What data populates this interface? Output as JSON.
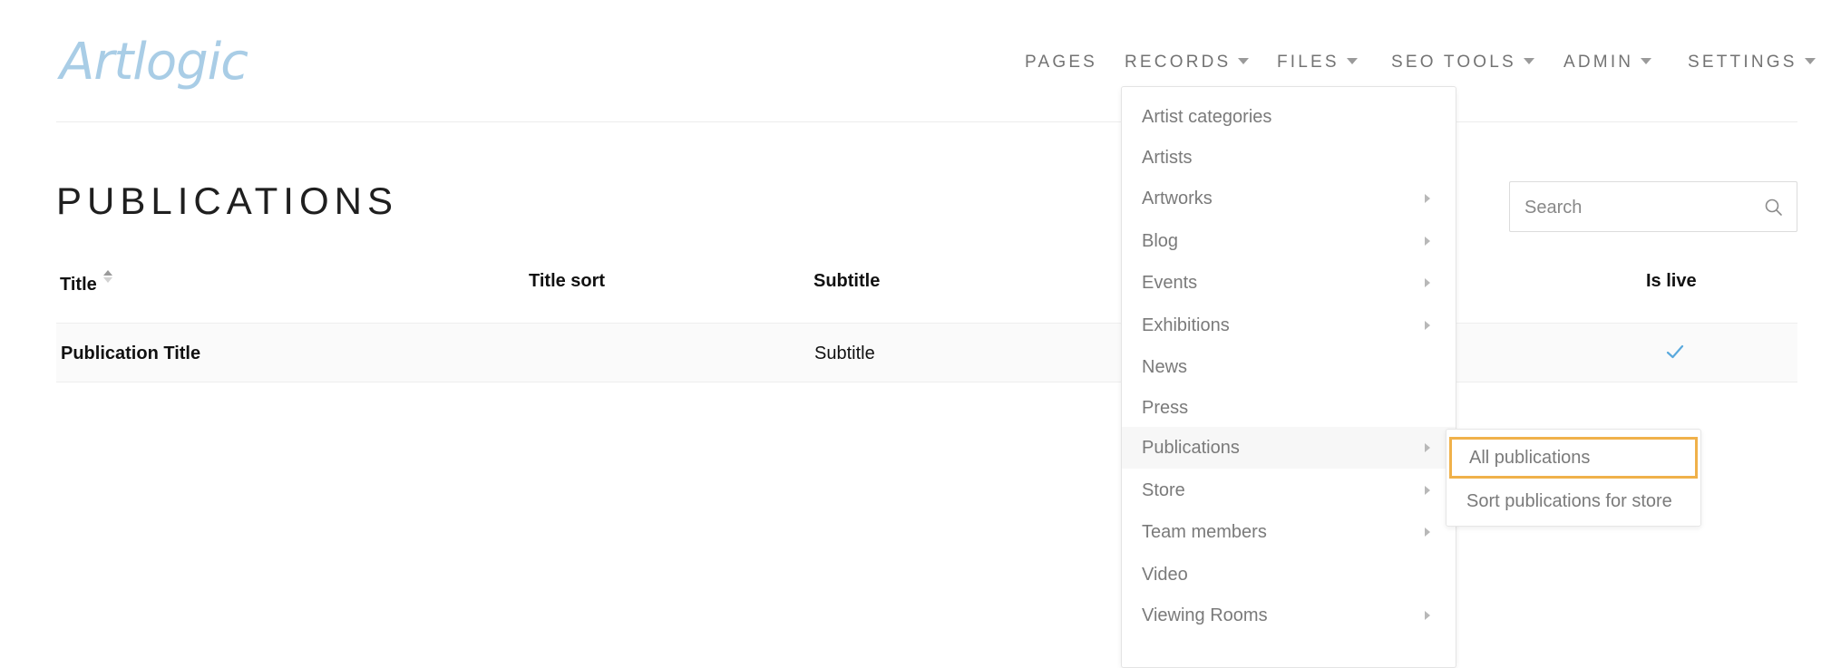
{
  "brand": {
    "logo_text": "Artlogic"
  },
  "nav": [
    {
      "label": "PAGES",
      "has_caret": false
    },
    {
      "label": "RECORDS",
      "has_caret": true
    },
    {
      "label": "FILES",
      "has_caret": true
    },
    {
      "label": "SEO TOOLS",
      "has_caret": true
    },
    {
      "label": "ADMIN",
      "has_caret": true
    },
    {
      "label": "SETTINGS",
      "has_caret": true
    }
  ],
  "page": {
    "title": "PUBLICATIONS"
  },
  "search": {
    "placeholder": "Search",
    "icon": "search-icon"
  },
  "table": {
    "columns": [
      "Title",
      "Title sort",
      "Subtitle",
      "Is live"
    ],
    "rows": [
      {
        "title": "Publication Title",
        "title_sort": "",
        "subtitle": "Subtitle",
        "is_live": true
      }
    ]
  },
  "records_menu": {
    "items": [
      {
        "label": "Artist categories",
        "has_submenu": false
      },
      {
        "label": "Artists",
        "has_submenu": false
      },
      {
        "label": "Artworks",
        "has_submenu": true
      },
      {
        "label": "Blog",
        "has_submenu": true
      },
      {
        "label": "Events",
        "has_submenu": true
      },
      {
        "label": "Exhibitions",
        "has_submenu": true
      },
      {
        "label": "News",
        "has_submenu": false
      },
      {
        "label": "Press",
        "has_submenu": false
      },
      {
        "label": "Publications",
        "has_submenu": true
      },
      {
        "label": "Store",
        "has_submenu": true
      },
      {
        "label": "Team members",
        "has_submenu": true
      },
      {
        "label": "Video",
        "has_submenu": false
      },
      {
        "label": "Viewing Rooms",
        "has_submenu": true
      }
    ],
    "active_item": "Publications"
  },
  "publications_submenu": {
    "items": [
      {
        "label": "All publications",
        "highlighted": true
      },
      {
        "label": "Sort publications for store",
        "highlighted": false
      }
    ]
  },
  "colors": {
    "logo": "#a9cde6",
    "highlight_border": "#f0b14a",
    "check": "#5aa9dd",
    "menu_text": "#7a7a7a"
  }
}
